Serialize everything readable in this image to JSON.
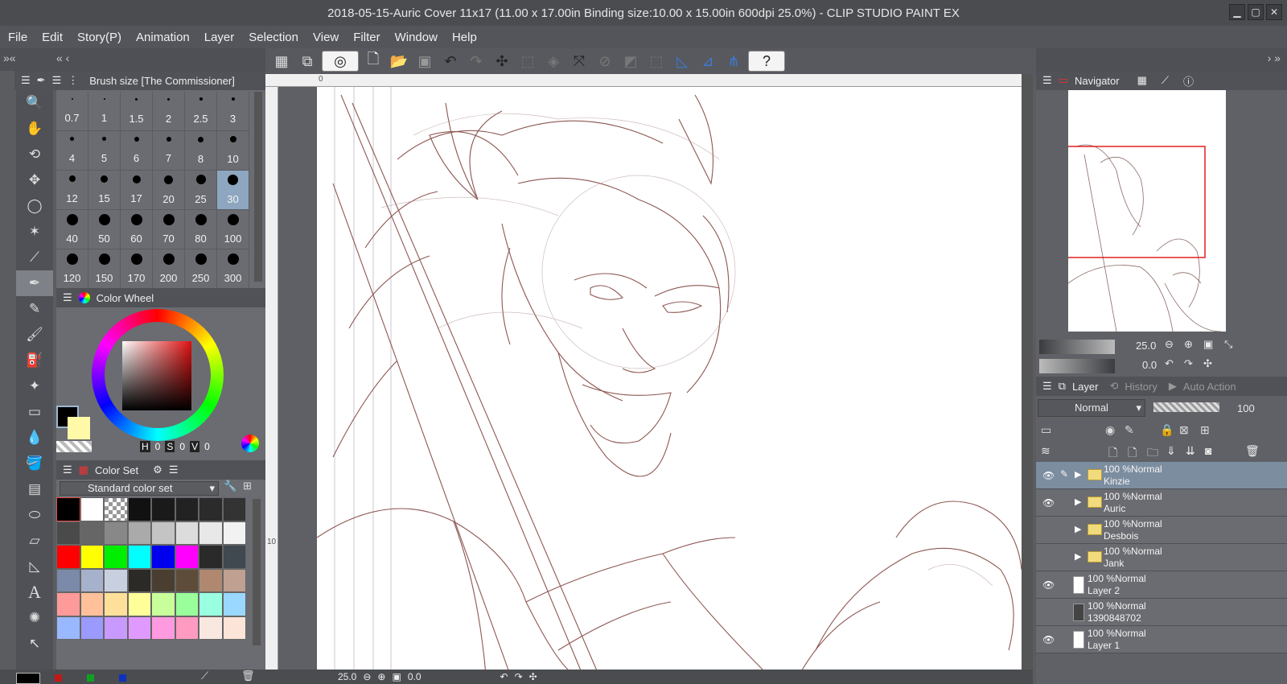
{
  "window": {
    "title": "2018-05-15-Auric Cover 11x17 (11.00 x 17.00in Binding size:10.00 x 15.00in 600dpi 25.0%)  - CLIP STUDIO PAINT EX",
    "min": "▁",
    "max": "▢",
    "close": "✕"
  },
  "menu": [
    "File",
    "Edit",
    "Story(P)",
    "Animation",
    "Layer",
    "Selection",
    "View",
    "Filter",
    "Window",
    "Help"
  ],
  "brush": {
    "header": "Brush size [The Commissioner]",
    "sizes": [
      "0.7",
      "1",
      "1.5",
      "2",
      "2.5",
      "3",
      "4",
      "5",
      "6",
      "7",
      "8",
      "10",
      "12",
      "15",
      "17",
      "20",
      "25",
      "30",
      "40",
      "50",
      "60",
      "70",
      "80",
      "100",
      "120",
      "150",
      "170",
      "200",
      "250",
      "300"
    ],
    "selected": "30"
  },
  "colorwheel": {
    "header": "Color Wheel",
    "h_label": "H",
    "h": "0",
    "s_label": "S",
    "s": "0",
    "v_label": "V",
    "v": "0",
    "main_color": "#000000",
    "sub_color": "#fff9a8"
  },
  "colorset": {
    "header": "Color Set",
    "set_name": "Standard color set",
    "swatches": [
      "#000000",
      "#ffffff",
      "#cccccc",
      "#111111",
      "#1a1a1a",
      "#222222",
      "#2b2b2b",
      "#333333",
      "#4a4a4a",
      "#666666",
      "#888888",
      "#aaaaaa",
      "#c4c4c4",
      "#dcdcdc",
      "#e8e8e8",
      "#f2f2f2",
      "#ff0000",
      "#ffff00",
      "#00ee00",
      "#00ffff",
      "#0000ee",
      "#ff00ff",
      "#2a2a2a",
      "#404850",
      "#7a8aa8",
      "#a6b2cc",
      "#c8d0e0",
      "#2c2a26",
      "#4a3e30",
      "#5e4c3a",
      "#b08870",
      "#c0a090",
      "#ff9a9a",
      "#ffc09a",
      "#ffe09a",
      "#ffff9a",
      "#c8ff9a",
      "#9aff9a",
      "#9affe0",
      "#9ad8ff",
      "#9ab8ff",
      "#9a9aff",
      "#c89aff",
      "#e09aff",
      "#ff9ae0",
      "#ff9ac0",
      "#f8e8e0",
      "#fce4d8"
    ],
    "bottom_colors": [
      "#c01818",
      "#10a020",
      "#1030c0"
    ]
  },
  "canvas": {
    "ruler_zero": "0",
    "ruler_ten": "10",
    "zoom": "25.0",
    "angle": "0.0"
  },
  "navigator": {
    "tab": "Navigator",
    "zoom": "25.0",
    "angle": "0.0"
  },
  "layers": {
    "tabs": [
      "Layer",
      "History",
      "Auto Action"
    ],
    "blend": "Normal",
    "opacity": "100",
    "rows": [
      {
        "line1": "100 %Normal",
        "line2": "Kinzie",
        "type": "folder",
        "eye": true,
        "selected": true
      },
      {
        "line1": "100 %Normal",
        "line2": "Auric",
        "type": "folder",
        "eye": true,
        "selected": false
      },
      {
        "line1": "100 %Normal",
        "line2": "Desbois",
        "type": "folder",
        "eye": false,
        "selected": false
      },
      {
        "line1": "100 %Normal",
        "line2": "Jank",
        "type": "folder",
        "eye": false,
        "selected": false
      },
      {
        "line1": "100 %Normal",
        "line2": "Layer 2",
        "type": "raster",
        "eye": true,
        "selected": false
      },
      {
        "line1": "100 %Normal",
        "line2": "1390848702",
        "type": "image",
        "eye": false,
        "selected": false
      },
      {
        "line1": "100 %Normal",
        "line2": "Layer 1",
        "type": "raster",
        "eye": true,
        "selected": false
      }
    ]
  },
  "icons": [
    "zoom-icon",
    "hand-icon",
    "rotate-icon",
    "move-icon",
    "lasso-icon",
    "magic-wand-icon",
    "eyedropper-icon",
    "pen-icon",
    "pencil-icon",
    "brush-icon",
    "airbrush-icon",
    "decoration-icon",
    "eraser-icon",
    "blend-icon",
    "fill-icon",
    "gradient-icon",
    "figure-icon",
    "frame-icon",
    "ruler-icon",
    "text-icon",
    "balloon-icon",
    "line-correction-icon"
  ]
}
